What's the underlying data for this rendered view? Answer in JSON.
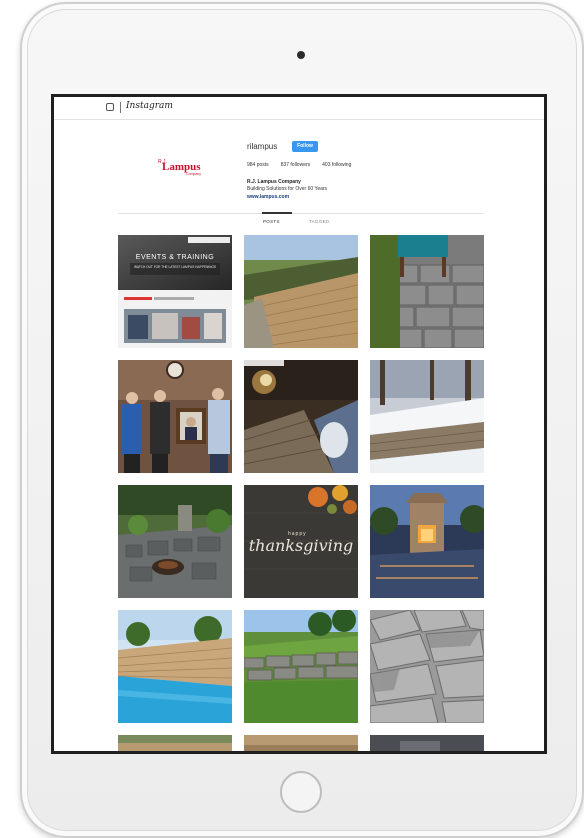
{
  "browser": {
    "app_name": "Instagram"
  },
  "profile": {
    "username": "rilampus",
    "follow_label": "Follow",
    "stats": {
      "posts": "984 posts",
      "followers": "837 followers",
      "following": "403 following"
    },
    "full_name": "R.J. Lampus Company",
    "bio": "Building Solutions for Over 60 Years",
    "website": "www.lampus.com",
    "logo_text": "Lampus",
    "logo_prefix": "R.J.",
    "logo_suffix": "Company"
  },
  "tabs": [
    {
      "label": "POSTS",
      "active": true
    },
    {
      "label": "TAGGED",
      "active": false
    }
  ],
  "posts": [
    {
      "kind": "events-graphic",
      "title": "EVENTS & TRAINING",
      "subtitle": "WATCH OUT FOR THE LATEST LAMPUS HAPPENINGS"
    },
    {
      "kind": "retaining-wall"
    },
    {
      "kind": "pavers-chair"
    },
    {
      "kind": "men-portrait"
    },
    {
      "kind": "fire-pit-night"
    },
    {
      "kind": "snow-wall"
    },
    {
      "kind": "patio-garden"
    },
    {
      "kind": "thanksgiving",
      "word_small": "happy",
      "word_large": "thanksgiving"
    },
    {
      "kind": "outdoor-fireplace"
    },
    {
      "kind": "pool-wall"
    },
    {
      "kind": "boulder-wall"
    },
    {
      "kind": "grey-pavers"
    }
  ],
  "colors": {
    "follow_blue": "#3897f0",
    "logo_red": "#c8102e"
  }
}
